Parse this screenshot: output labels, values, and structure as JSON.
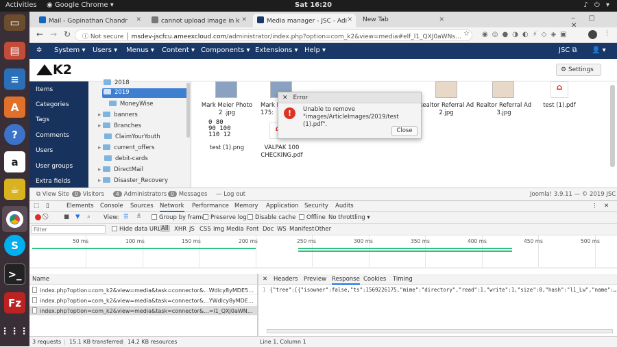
{
  "topbar": {
    "activities": "Activities",
    "app": "Google Chrome",
    "clock": "Sat 16:20",
    "tray": "♪ ⏻ ▾"
  },
  "browser": {
    "tabs": [
      {
        "label": "Mail - Gopinathan Chandr",
        "color": "#1565c0"
      },
      {
        "label": "cannot upload image in k",
        "color": "#555"
      },
      {
        "label": "Media manager - JSC - Adi",
        "color": "#1a3867"
      },
      {
        "label": "New Tab",
        "color": ""
      }
    ],
    "url_prefix": "Not secure",
    "url_host": "msdev-jscfcu.ameexcloud.com",
    "url_path": "/administrator/index.php?option=com_k2&view=media#elf_l1_QXJ0aWNsZUltY..."
  },
  "joomla": {
    "menu": [
      "System ▾",
      "Users ▾",
      "Menus ▾",
      "Content ▾",
      "Components ▾",
      "Extensions ▾",
      "Help ▾"
    ],
    "site": "JSC ⧉",
    "user": "👤 ▾",
    "logo": "K2",
    "settings": "Settings",
    "sidebar": [
      "Items",
      "Categories",
      "Tags",
      "Comments",
      "Users",
      "User groups",
      "Extra fields"
    ],
    "tree": [
      {
        "label": "2018",
        "indent": 1
      },
      {
        "label": "2019",
        "indent": 1,
        "selected": true
      },
      {
        "label": "MoneyWise",
        "indent": 2
      },
      {
        "label": "banners",
        "indent": 0
      },
      {
        "label": "Branches",
        "indent": 0
      },
      {
        "label": "ClaimYourYouth",
        "indent": 0
      },
      {
        "label": "current_offers",
        "indent": 0
      },
      {
        "label": "debit-cards",
        "indent": 0
      },
      {
        "label": "DirectMail",
        "indent": 0
      },
      {
        "label": "Disaster_Recovery",
        "indent": 0
      }
    ],
    "files_row1": [
      "Mark Meier Photo 2 .jpg",
      "Mark M 175:",
      "Realtor Referral Ad 2.jpg",
      "Realtor Referral Ad 3.jpg",
      "test (1).pdf"
    ],
    "files_row2": [
      "test (1).png",
      "VALPAK 100 CHECKING.pdf"
    ],
    "png_preview": "0 80\n90 100\n110 12",
    "error": {
      "title": "Error",
      "message": "Unable to remove \"images/ArticleImages/2019/test (1).pdf\".",
      "close": "Close"
    },
    "status": {
      "view_site": "View Site",
      "visitors_count": "0",
      "visitors": "Visitors",
      "admins_count": "4",
      "admins": "Administrators",
      "messages_count": "0",
      "messages": "Messages",
      "logout": "Log out",
      "version": "Joomla! 3.9.11 — © 2019 JSC"
    }
  },
  "devtools": {
    "tabs": [
      "Elements",
      "Console",
      "Sources",
      "Network",
      "Performance",
      "Memory",
      "Application",
      "Security",
      "Audits"
    ],
    "toolbar": {
      "view": "View:",
      "group": "Group by frame",
      "preserve": "Preserve log",
      "cache": "Disable cache",
      "offline": "Offline",
      "throttle": "No throttling ▾"
    },
    "filter_placeholder": "Filter",
    "hide_data": "Hide data URLs",
    "types": [
      "All",
      "XHR",
      "JS",
      "CSS",
      "Img",
      "Media",
      "Font",
      "Doc",
      "WS",
      "Manifest",
      "Other"
    ],
    "ticks": [
      "50 ms",
      "100 ms",
      "150 ms",
      "200 ms",
      "250 ms",
      "300 ms",
      "350 ms",
      "400 ms",
      "450 ms",
      "500 ms"
    ],
    "name_header": "Name",
    "requests": [
      "index.php?option=com_k2&view=media&task=connector&...Wdlcy8yMDE5L3Rlc3Qg...",
      "index.php?option=com_k2&view=media&task=connector&...YWdlcy8yMDE5&tree=1...",
      "index.php?option=com_k2&view=media&task=connector&...=l1_QXJ0aWNsZUltYWd..."
    ],
    "resp_tabs": [
      "Headers",
      "Preview",
      "Response",
      "Cookies",
      "Timing"
    ],
    "response_line_no": "1",
    "response": "{\"tree\":[{\"isowner\":false,\"ts\":1569226175,\"mime\":\"directory\",\"read\":1,\"write\":1,\"size\":0,\"hash\":\"l1_Lw\",\"name\":\"ima",
    "summary": {
      "requests": "3 requests",
      "transferred": "15.1 KB transferred",
      "resources": "14.2 KB resources",
      "position": "Line 1, Column 1"
    }
  }
}
